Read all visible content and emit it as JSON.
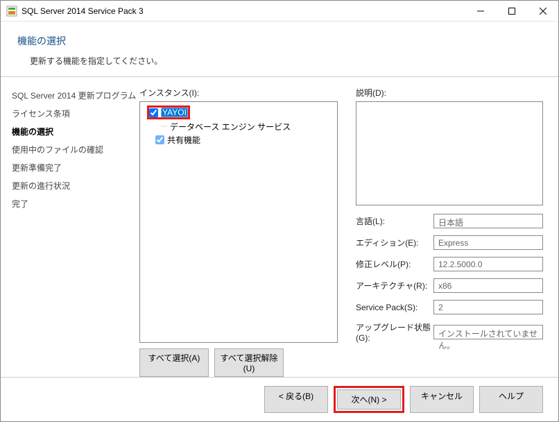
{
  "window": {
    "title": "SQL Server 2014 Service Pack 3"
  },
  "header": {
    "title": "機能の選択",
    "subtitle": "更新する機能を指定してください。"
  },
  "sidebar": {
    "items": [
      {
        "label": "SQL Server 2014 更新プログラム",
        "active": false
      },
      {
        "label": "ライセンス条項",
        "active": false
      },
      {
        "label": "機能の選択",
        "active": true
      },
      {
        "label": "使用中のファイルの確認",
        "active": false
      },
      {
        "label": "更新準備完了",
        "active": false
      },
      {
        "label": "更新の進行状況",
        "active": false
      },
      {
        "label": "完了",
        "active": false
      }
    ]
  },
  "instances": {
    "label": "インスタンス(I):",
    "tree": {
      "root": {
        "label": "YAYOI",
        "checked": true
      },
      "child": {
        "label": "データベース エンジン サービス"
      },
      "shared": {
        "label": "共有機能",
        "checked": true
      }
    },
    "select_all": "すべて選択(A)",
    "deselect_all": "すべて選択解除(U)"
  },
  "details": {
    "desc_label": "説明(D):",
    "rows": {
      "language": {
        "label": "言語(L):",
        "value": "日本語"
      },
      "edition": {
        "label": "エディション(E):",
        "value": "Express"
      },
      "patch": {
        "label": "修正レベル(P):",
        "value": "12.2.5000.0"
      },
      "arch": {
        "label": "アーキテクチャ(R):",
        "value": "x86"
      },
      "sp": {
        "label": "Service Pack(S):",
        "value": "2"
      },
      "upgrade": {
        "label": "アップグレード状態(G):",
        "value": "インストールされていません。"
      }
    }
  },
  "footer": {
    "back": "< 戻る(B)",
    "next": "次へ(N) >",
    "cancel": "キャンセル",
    "help": "ヘルプ"
  }
}
